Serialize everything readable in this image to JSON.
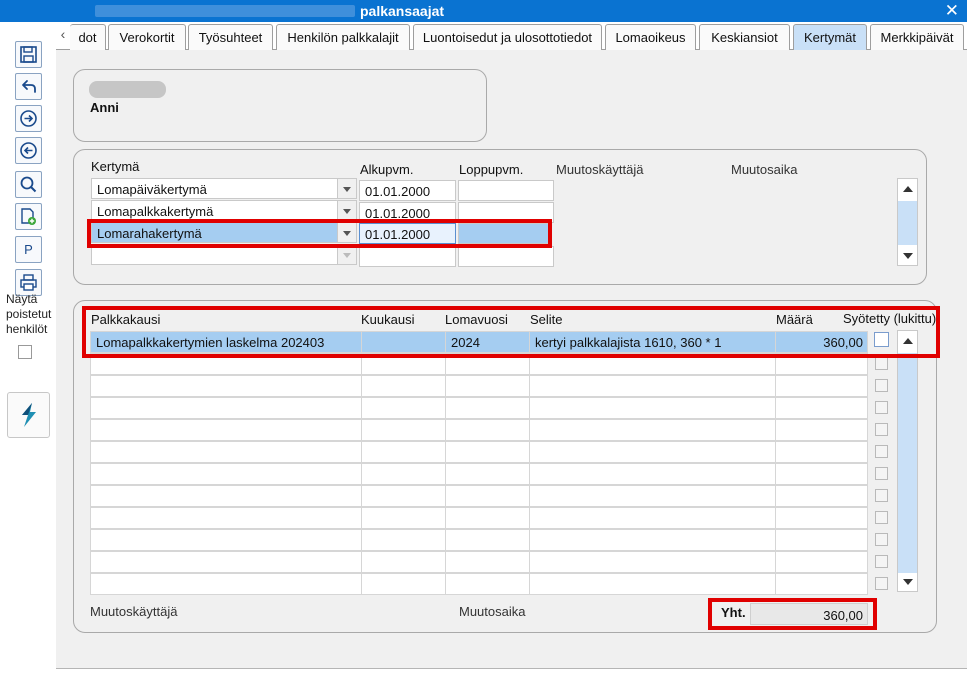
{
  "window": {
    "title": "palkansaajat",
    "close_glyph": "✕"
  },
  "toolbar": {
    "buttons": [
      {
        "name": "save-icon"
      },
      {
        "name": "undo-icon"
      },
      {
        "name": "forward-icon"
      },
      {
        "name": "back-icon"
      },
      {
        "name": "search-icon"
      },
      {
        "name": "new-document-icon"
      },
      {
        "name": "p-button",
        "label": "P"
      },
      {
        "name": "print-icon"
      }
    ],
    "show_deleted_label": "Näytä poistetut henkilöt",
    "app_logo_icon": "app-logo-icon"
  },
  "tabs": [
    {
      "label": "dot"
    },
    {
      "label": "Verokortit"
    },
    {
      "label": "Työsuhteet"
    },
    {
      "label": "Henkilön palkkalajit"
    },
    {
      "label": "Luontoisedut ja ulosottotiedot"
    },
    {
      "label": "Lomaoikeus"
    },
    {
      "label": "Keskiansiot"
    },
    {
      "label": "Kertymät",
      "active": true
    },
    {
      "label": "Merkkipäivät"
    }
  ],
  "person": {
    "name": "Anni"
  },
  "kertyma": {
    "headers": {
      "kertyma": "Kertymä",
      "alkupvm": "Alkupvm.",
      "loppupvm": "Loppupvm.",
      "muutoskayttaja": "Muutoskäyttäjä",
      "muutosaika": "Muutosaika"
    },
    "rows": [
      {
        "kertyma": "Lomapäiväkertymä",
        "alkupvm": "01.01.2000",
        "loppupvm": ""
      },
      {
        "kertyma": "Lomapalkkakertymä",
        "alkupvm": "01.01.2000",
        "loppupvm": ""
      },
      {
        "kertyma": "Lomarahakertymä",
        "alkupvm": "01.01.2000",
        "loppupvm": "",
        "selected": true
      },
      {
        "kertyma": "",
        "alkupvm": "",
        "loppupvm": ""
      }
    ]
  },
  "palkka": {
    "headers": {
      "palkkakausi": "Palkkakausi",
      "kuukausi": "Kuukausi",
      "lomavuosi": "Lomavuosi",
      "selite": "Selite",
      "maara": "Määrä",
      "syotetty": "Syötetty (lukittu)"
    },
    "rows": [
      {
        "palkkakausi": "Lomapalkkakertymien laskelma 202403",
        "kuukausi": "",
        "lomavuosi": "2024",
        "selite": "kertyi palkkalajista 1610, 360 * 1",
        "maara": "360,00",
        "selected": true
      }
    ],
    "empty_row_count": 11,
    "footer": {
      "muutoskayttaja": "Muutoskäyttäjä",
      "muutosaika": "Muutosaika",
      "total_label": "Yht.",
      "total_value": "360,00"
    }
  },
  "colors": {
    "titlebar": "#0a73d1",
    "selection": "#a5cdf1",
    "active_tab": "#c9e0f7",
    "highlight_box": "#e00000"
  }
}
